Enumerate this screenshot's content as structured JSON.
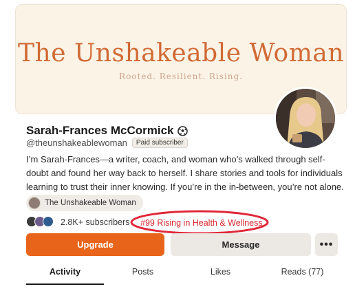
{
  "banner": {
    "title": "The Unshakeable Woman",
    "tagline": "Rooted. Resilient. Rising."
  },
  "profile": {
    "name": "Sarah-Frances McCormick",
    "handle": "@theunshakeablewoman",
    "paid_badge": "Paid subscriber",
    "bio": "I’m Sarah-Frances—a writer, coach, and woman who’s walked through self-doubt and found her way back to herself. I share stories and tools for individuals learning to trust their inner knowing. If you’re in the in-between, you’re not alone."
  },
  "publication": {
    "name": "The Unshakeable Woman"
  },
  "stats": {
    "subscribers": "2.8K+ subscribers",
    "rank": "#99 Rising in Health & Wellness"
  },
  "actions": {
    "upgrade": "Upgrade",
    "message": "Message",
    "more": "•••"
  },
  "tabs": [
    {
      "label": "Activity",
      "active": true
    },
    {
      "label": "Posts"
    },
    {
      "label": "Likes"
    },
    {
      "label": "Reads (77)"
    }
  ],
  "colors": {
    "brand_orange": "#e8641a",
    "banner_text": "#d16a35",
    "banner_bg": "#fbf3e6",
    "highlight_red": "#d6272d"
  },
  "icons": {
    "verified_badge": "soccer-ball-badge-icon",
    "more": "more-horizontal-icon"
  }
}
